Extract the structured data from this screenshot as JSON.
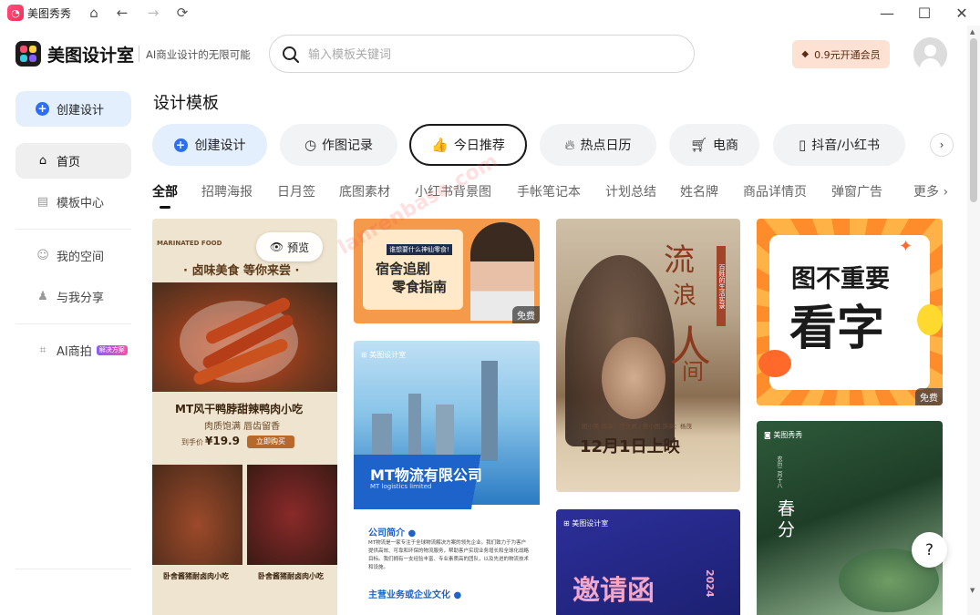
{
  "window": {
    "app_name": "美图秀秀",
    "controls": {
      "minimize": "—",
      "maximize": "☐",
      "close": "✕"
    }
  },
  "header": {
    "brand": "美图设计室",
    "slogan": "AI商业设计的无限可能",
    "search_placeholder": "输入模板关键词",
    "vip_label": "0.9元开通会员"
  },
  "sidebar": {
    "create": "创建设计",
    "items": [
      {
        "label": "首页",
        "icon": "home-icon"
      },
      {
        "label": "模板中心",
        "icon": "template-icon"
      },
      {
        "label": "我的空间",
        "icon": "user-icon"
      },
      {
        "label": "与我分享",
        "icon": "share-icon"
      },
      {
        "label": "AI商拍",
        "icon": "ai-shot-icon",
        "badge": "解决方案"
      }
    ]
  },
  "main": {
    "title": "设计模板",
    "chips": [
      {
        "label": "创建设计",
        "icon": "plus-icon"
      },
      {
        "label": "作图记录",
        "icon": "clock-icon"
      },
      {
        "label": "今日推荐",
        "icon": "thumbs-up-icon"
      },
      {
        "label": "热点日历",
        "icon": "fire-icon"
      },
      {
        "label": "电商",
        "icon": "cart-icon"
      },
      {
        "label": "抖音/小红书",
        "icon": "book-icon"
      }
    ],
    "categories": [
      "全部",
      "招聘海报",
      "日月签",
      "底图素材",
      "小红书背景图",
      "手帐笔记本",
      "计划总结",
      "姓名牌",
      "商品详情页",
      "弹窗广告",
      "更多"
    ],
    "preview_label": "预览",
    "free_label": "免费",
    "help_label": "?"
  },
  "cards": {
    "food": {
      "top_label": "MARINATED FOOD",
      "headline": "· 卤味美食 等你来尝 ·",
      "title": "MT风干鸭脖甜辣鸭肉小吃",
      "sub": "肉质饱满 唇齿留香",
      "price_prefix": "到手价",
      "price": "¥19.9",
      "buy": "立即购买",
      "item1": "卧舍酱猪耐卤肉小吃",
      "item2": "卧舍酱猪耐卤肉小吃"
    },
    "snack": {
      "line1": "谁想要什么神仙零食!",
      "line2": "宿舍追剧",
      "line3": "零食指南"
    },
    "logistics": {
      "brand": "美图设计室",
      "title": "MT物流有限公司",
      "sub": "MT logistics limited",
      "intro_title": "公司简介",
      "intro_body": "MT物流是一家专注于全球物流解决方案的领先企业。我们致力于为客户提供高效、可靠和环保的物流服务，帮助客户实现业务增长和全球化战略目标。我们拥有一支经验丰富、专业素质高的团队，以及先进的物流技术和设施。",
      "section2": "主营业务或企业文化"
    },
    "movie": {
      "title_a": "流",
      "title_b": "浪",
      "title_c": "人",
      "title_d": "间",
      "tag": "百姓的生活实录",
      "credits": "图小美 饰演：范文君 / 美小图 饰演：杨茂",
      "date": "12月1日上映"
    },
    "text_poster": {
      "line1": "图不重要",
      "line2": "看字"
    },
    "invite": {
      "brand": "美图设计室",
      "title": "邀请函",
      "year": "2024"
    },
    "spring": {
      "brand": "美图秀秀",
      "solar_term": "春分",
      "small": "农历二月十八"
    }
  },
  "watermark": "lanrenbase.com"
}
